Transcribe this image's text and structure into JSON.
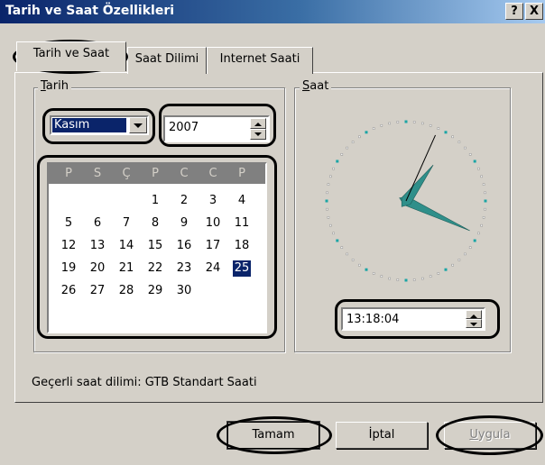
{
  "window": {
    "title": "Tarih ve Saat Özellikleri",
    "help_label": "?",
    "close_label": "X"
  },
  "tabs": [
    {
      "label": "Tarih ve Saat",
      "active": true
    },
    {
      "label": "Saat Dilimi",
      "active": false
    },
    {
      "label": "Internet Saati",
      "active": false
    }
  ],
  "date_group": {
    "label_mnemonic": "T",
    "label_rest": "arih",
    "month_value": "Kasım",
    "year_value": "2007"
  },
  "calendar": {
    "weekday_headers": [
      "P",
      "S",
      "Ç",
      "P",
      "C",
      "C",
      "P"
    ],
    "rows": [
      [
        "",
        "",
        "",
        "1",
        "2",
        "3",
        "4"
      ],
      [
        "5",
        "6",
        "7",
        "8",
        "9",
        "10",
        "11"
      ],
      [
        "12",
        "13",
        "14",
        "15",
        "16",
        "17",
        "18"
      ],
      [
        "19",
        "20",
        "21",
        "22",
        "23",
        "24",
        "25"
      ],
      [
        "26",
        "27",
        "28",
        "29",
        "30",
        "",
        ""
      ]
    ],
    "selected_day": "25"
  },
  "time_group": {
    "label_mnemonic": "S",
    "label_rest": "aat",
    "time_value": "13:18:04"
  },
  "status": {
    "text": "Geçerli saat dilimi:  GTB Standart Saati"
  },
  "buttons": {
    "ok_label": "Tamam",
    "cancel_label": "İptal",
    "apply_mnemonic": "U",
    "apply_rest": "ygula"
  },
  "colors": {
    "face": "#d4d0c8",
    "highlight": "#0a246a",
    "clock_hand": "#2f8f8a"
  }
}
